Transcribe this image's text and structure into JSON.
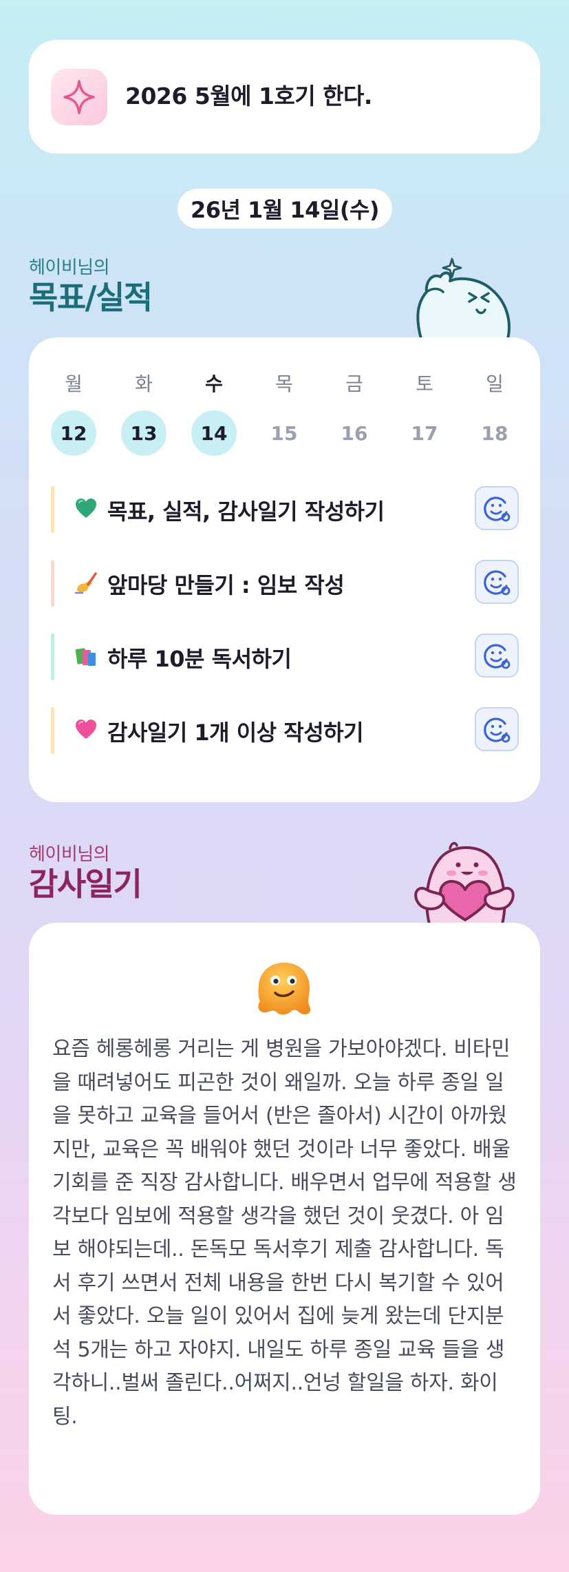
{
  "goal": {
    "text": "2026 5월에 1호기 한다.",
    "icon": "sparkle-icon"
  },
  "date": "26년 1월 14일(수)",
  "goals_section": {
    "owner": "헤이비님의",
    "title": "목표/실적"
  },
  "week": [
    {
      "day": "월",
      "date": "12",
      "done": true
    },
    {
      "day": "화",
      "date": "13",
      "done": true
    },
    {
      "day": "수",
      "date": "14",
      "done": true,
      "current": true
    },
    {
      "day": "목",
      "date": "15",
      "done": false
    },
    {
      "day": "금",
      "date": "16",
      "done": false
    },
    {
      "day": "토",
      "date": "17",
      "done": false
    },
    {
      "day": "일",
      "date": "18",
      "done": false
    }
  ],
  "tasks": [
    {
      "emoji": "green-heart-icon",
      "label": "목표, 실적, 감사일기 작성하기",
      "bar_color": "#fde3b8"
    },
    {
      "emoji": "writing-hand-icon",
      "label": "앞마당 만들기 : 임보 작성",
      "bar_color": "#fbd8cc"
    },
    {
      "emoji": "books-icon",
      "label": "하루 10분 독서하기",
      "bar_color": "#c2ede0"
    },
    {
      "emoji": "pink-heart-icon",
      "label": "감사일기 1개 이상 작성하기",
      "bar_color": "#fde3b8"
    }
  ],
  "gratitude_section": {
    "owner": "헤이비님의",
    "title": "감사일기"
  },
  "gratitude": {
    "mood_icon": "melting-face-icon",
    "text": "요즘 헤롱헤롱 거리는 게 병원을 가보아야겠다. 비타민을 때려넣어도 피곤한 것이 왜일까. 오늘 하루 종일 일을 못하고 교육을 들어서 (반은 졸아서) 시간이 아까웠지만, 교육은 꼭 배워야 했던 것이라 너무 좋았다. 배울 기회를 준 직장 감사합니다. 배우면서 업무에 적용할 생각보다 임보에 적용할 생각을 했던 것이 웃겼다. 아 임보 해야되는데.. 돈독모 독서후기 제출 감사합니다. 독서 후기 쓰면서 전체 내용을 한번 다시 복기할 수 있어서 좋았다. 오늘 일이 있어서 집에 늦게 왔는데 단지분석 5개는 하고 자야지. 내일도 하루 종일 교육 들을 생각하니..벌써 졸린다..어쩌지..언넝 할일을 하자. 화이팅."
  },
  "colors": {
    "accent_teal": "#1d6d78",
    "accent_pink": "#8c2460",
    "done_circle": "#c8f0f4",
    "icon_blue": "#3a63d6"
  }
}
